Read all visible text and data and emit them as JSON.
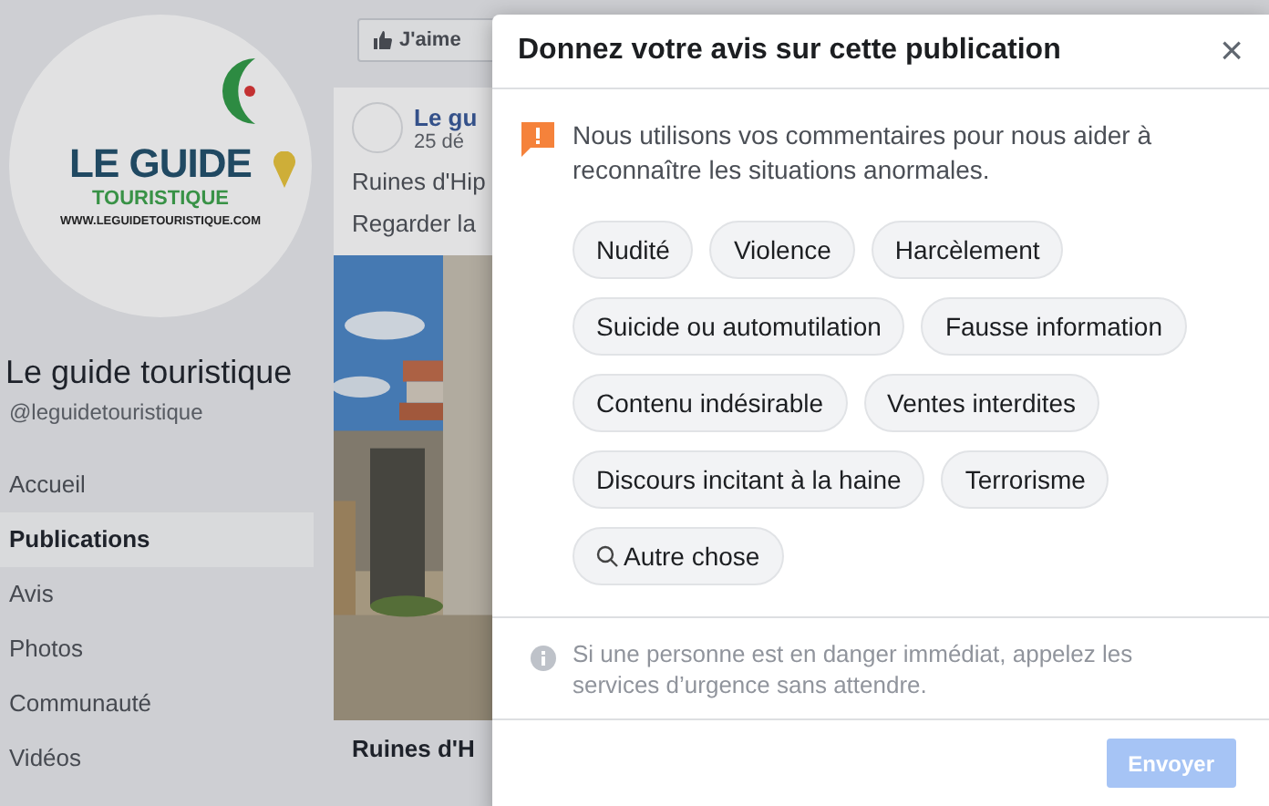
{
  "background": {
    "logo": {
      "line_1": "LE GUIDE",
      "line_2": "TOURISTIQUE",
      "url": "WWW.LEGUIDETOURISTIQUE.COM"
    },
    "page_name": "Le guide touristique",
    "page_handle": "@leguidetouristique",
    "sidebar": {
      "items": [
        {
          "label": "Accueil",
          "selected": false
        },
        {
          "label": "Publications",
          "selected": true
        },
        {
          "label": "Avis",
          "selected": false
        },
        {
          "label": "Photos",
          "selected": false
        },
        {
          "label": "Communauté",
          "selected": false
        },
        {
          "label": "Vidéos",
          "selected": false
        }
      ]
    },
    "like_button": {
      "label": "J'aime"
    },
    "post": {
      "author": "Le gu",
      "date": "25 dé",
      "lines": [
        "Ruines d'Hip",
        "Regarder la"
      ],
      "caption": "Ruines d'H"
    }
  },
  "dialog": {
    "title": "Donnez votre avis sur cette publication",
    "close": "×",
    "notice": "Nous utilisons vos commentaires pour nous aider à reconnaître les situations anormales.",
    "chip_rows": [
      {
        "chips": [
          {
            "label": "Nudité",
            "kind": "topic",
            "selected": false
          },
          {
            "label": "Violence",
            "kind": "topic",
            "selected": false
          },
          {
            "label": "Harcèlement",
            "kind": "topic",
            "selected": false
          }
        ]
      },
      {
        "chips": [
          {
            "label": "Suicide ou automutilation",
            "kind": "topic",
            "selected": false
          },
          {
            "label": "Fausse information",
            "kind": "topic",
            "selected": false
          }
        ]
      },
      {
        "chips": [
          {
            "label": "Contenu indésirable",
            "kind": "topic",
            "selected": false
          },
          {
            "label": "Ventes interdites",
            "kind": "topic",
            "selected": false
          }
        ]
      },
      {
        "chips": [
          {
            "label": "Discours incitant à la haine",
            "kind": "topic",
            "selected": false
          },
          {
            "label": "Terrorisme",
            "kind": "topic",
            "selected": false
          }
        ]
      },
      {
        "chips": [
          {
            "label": "Autre chose",
            "kind": "search",
            "selected": false
          }
        ]
      }
    ],
    "emergency_note": "Si une personne est en danger immédiat, appelez les services d’urgence sans attendre.",
    "submit": {
      "label": "Envoyer",
      "disabled": true
    }
  }
}
